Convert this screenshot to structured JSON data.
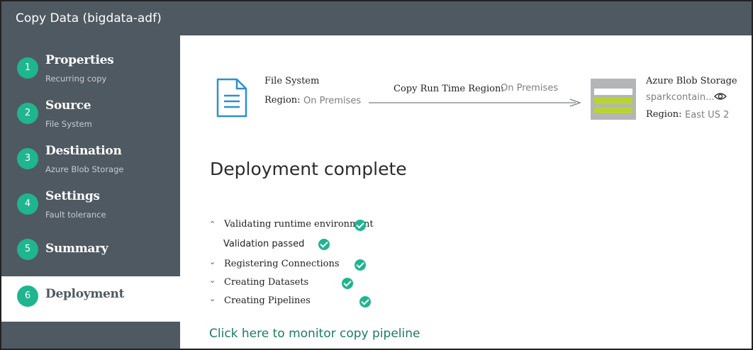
{
  "window": {
    "title": "Copy Data (bigdata-adf)"
  },
  "steps": [
    {
      "number": "1",
      "label": "Properties",
      "sub": "Recurring copy"
    },
    {
      "number": "2",
      "label": "Source",
      "sub": "File System"
    },
    {
      "number": "3",
      "label": "Destination",
      "sub": "Azure Blob Storage"
    },
    {
      "number": "4",
      "label": "Settings",
      "sub": "Fault tolerance"
    },
    {
      "number": "5",
      "label": "Summary",
      "sub": ""
    },
    {
      "number": "6",
      "label": "Deployment",
      "sub": ""
    }
  ],
  "active_step": "6",
  "flow": {
    "source": {
      "name": "File System",
      "region_label": "Region:",
      "region_value": "On Premises",
      "icon": "document-icon"
    },
    "runtime": {
      "label": "Copy Run Time Region:",
      "value": "On Premises"
    },
    "destination": {
      "name": "Azure Blob Storage",
      "container": "sparkcontain...",
      "region_label": "Region:",
      "region_value": "East US 2",
      "icon": "blob-storage-icon"
    }
  },
  "deployment": {
    "title": "Deployment complete",
    "tasks": [
      {
        "label": "Validating runtime environment",
        "expanded": true,
        "detail": "Validation passed"
      },
      {
        "label": "Registering Connections",
        "expanded": false
      },
      {
        "label": "Creating Datasets",
        "expanded": false
      },
      {
        "label": "Creating Pipelines",
        "expanded": false
      }
    ],
    "monitor_link": "Click here to monitor copy pipeline"
  },
  "colors": {
    "sidebar": "#4f5961",
    "accent": "#1fb58f",
    "link": "#1e7a66",
    "icon_blue": "#2e8fd0"
  }
}
